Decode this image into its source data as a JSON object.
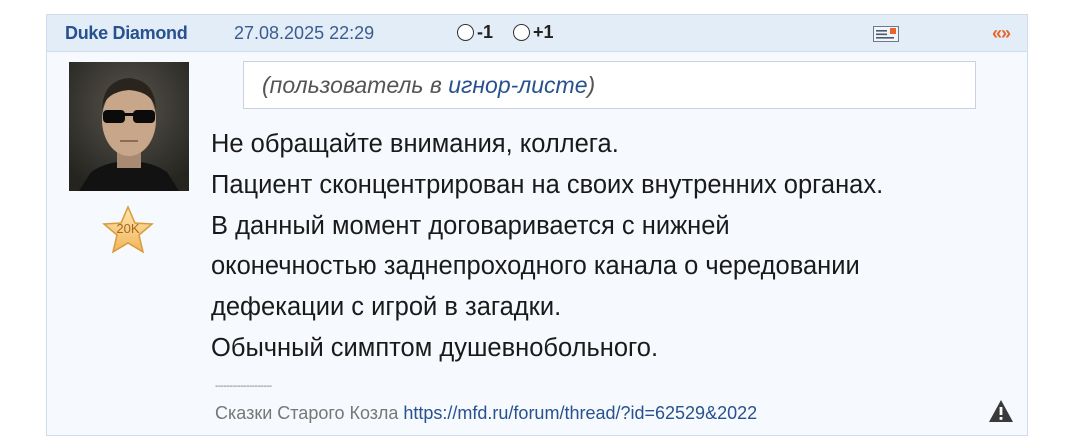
{
  "post": {
    "author": "Duke Diamond",
    "datetime": "27.08.2025 22:29",
    "vote_minus_label": "-1",
    "vote_plus_label": "+1",
    "quote_label": "«»",
    "rating_badge": "20K",
    "ignore_notice": {
      "prefix": "(пользователь в ",
      "link": "игнор-листе",
      "suffix": ")"
    },
    "message_lines": [
      "Не обращайте внимания, коллега.",
      "Пациент сконцентрирован на своих внутренних органах.",
      "В данный момент договаривается с нижней",
      "оконечностью заднепроходного канала о чередовании",
      "дефекации с игрой в загадки.",
      "Обычный симптом душевнобольного."
    ],
    "signature_separator": "--------------------",
    "signature_text": "Сказки Старого Козла ",
    "signature_link": "https://mfd.ru/forum/thread/?id=62529&2022",
    "colors": {
      "header_bg": "#e3edf8",
      "author": "#27518f",
      "link": "#27518f",
      "quote": "#e8642a"
    },
    "icons": {
      "reply": "reply-icon",
      "quote": "quote-icon",
      "badge": "star-badge-icon",
      "report": "warning-icon"
    }
  }
}
